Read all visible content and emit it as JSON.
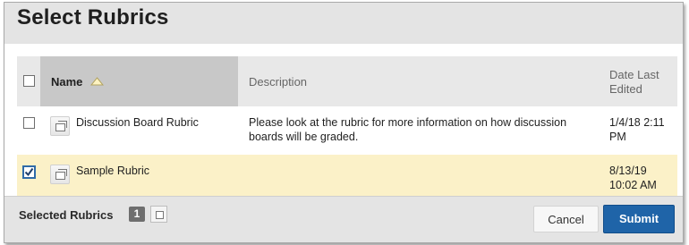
{
  "dialog": {
    "title": "Select Rubrics"
  },
  "table": {
    "headers": {
      "name": "Name",
      "description": "Description",
      "date": "Date Last Edited"
    },
    "rows": [
      {
        "checked": false,
        "name": "Discussion Board Rubric",
        "description_line1": "Please look at the rubric for more information on how discussion",
        "description_line2": "boards will be graded.",
        "date_line1": "1/4/18 2:11",
        "date_line2": "PM"
      },
      {
        "checked": true,
        "name": "Sample Rubric",
        "description_line1": "",
        "description_line2": "",
        "date_line1": "8/13/19",
        "date_line2": "10:02 AM"
      }
    ]
  },
  "footer": {
    "selected_label": "Selected Rubrics",
    "selected_count": "1",
    "cancel_label": "Cancel",
    "submit_label": "Submit"
  },
  "colors": {
    "accent": "#1f64a8",
    "selected_row": "#fbf1c8",
    "header_bg": "#e8e8e8",
    "sorted_header_bg": "#c8c8c8"
  },
  "icons": {
    "sort": "sort-ascending-icon",
    "row_action": "open-window-icon",
    "checkmark": "checkmark-icon"
  }
}
